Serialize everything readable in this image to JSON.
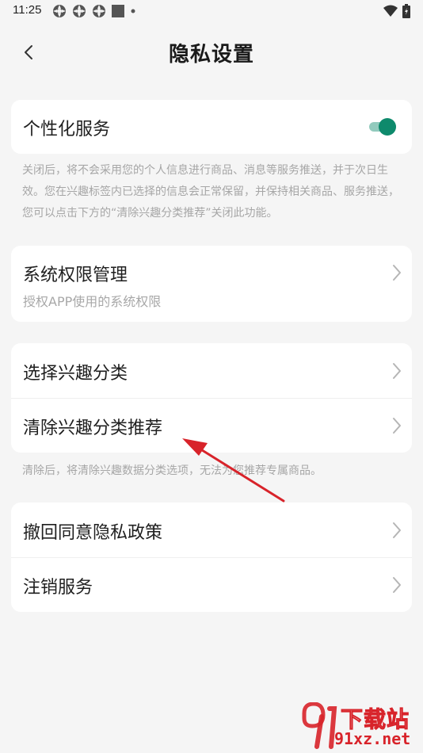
{
  "status_bar": {
    "time": "11:25",
    "icons": [
      "notification-icon",
      "notification-icon",
      "notification-icon",
      "square-icon",
      "dot-icon"
    ],
    "right_icons": [
      "wifi-icon",
      "battery-icon"
    ]
  },
  "header": {
    "title": "隐私设置"
  },
  "personalized": {
    "label": "个性化服务",
    "toggle_on": true,
    "accent_color": "#0e8a6c",
    "note": "关闭后，将不会采用您的个人信息进行商品、消息等服务推送，并于次日生效。您在兴趣标签内已选择的信息会正常保留，并保持相关商品、服务推送，您可以点击下方的“清除兴趣分类推荐”关闭此功能。"
  },
  "permissions": {
    "label": "系统权限管理",
    "sublabel": "授权APP使用的系统权限"
  },
  "interest": {
    "items": [
      {
        "label": "选择兴趣分类"
      },
      {
        "label": "清除兴趣分类推荐"
      }
    ],
    "note": "清除后，将清除兴趣数据分类选项，无法为您推荐专属商品。"
  },
  "account": {
    "items": [
      {
        "label": "撤回同意隐私政策"
      },
      {
        "label": "注销服务"
      }
    ]
  },
  "annotation": {
    "arrow_color": "#d8232a"
  },
  "watermark": {
    "logo_text": "91",
    "brand": "下载站",
    "domain": "91xz.net",
    "color": "#d8232a"
  }
}
